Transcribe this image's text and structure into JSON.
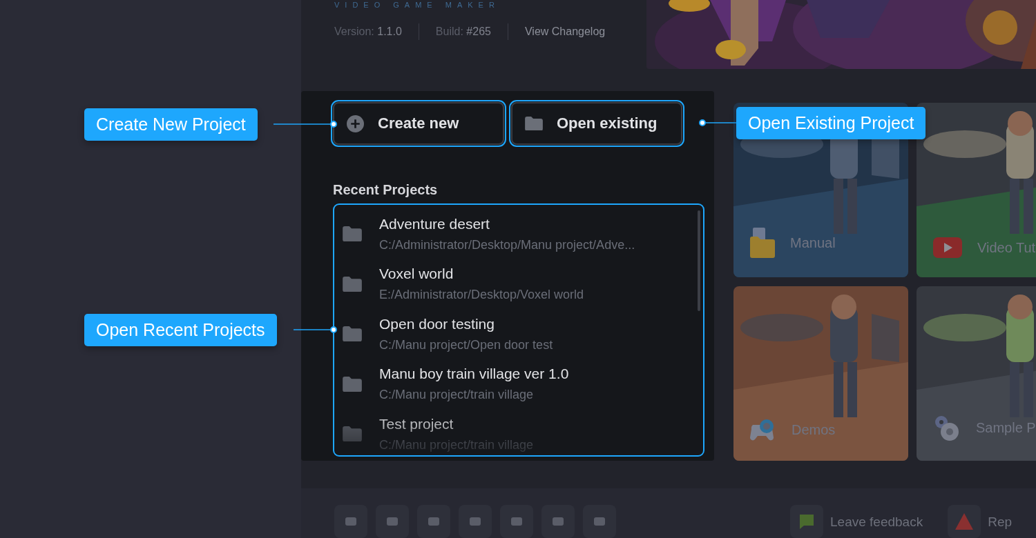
{
  "header": {
    "tagline": "VIDEO GAME MAKER",
    "version_label": "Version:",
    "version": "1.1.0",
    "build_label": "Build:",
    "build": "#265",
    "changelog": "View Changelog"
  },
  "actions": [
    {
      "kind": "create",
      "label": "Create new"
    },
    {
      "kind": "open",
      "label": "Open existing"
    }
  ],
  "recent": {
    "title": "Recent Projects",
    "items": [
      {
        "name": "Adventure desert",
        "path": "C:/Administrator/Desktop/Manu project/Adve..."
      },
      {
        "name": "Voxel world",
        "path": "E:/Administrator/Desktop/Voxel world"
      },
      {
        "name": "Open door testing",
        "path": "C:/Manu project/Open door test"
      },
      {
        "name": "Manu boy train village ver 1.0",
        "path": "C:/Manu project/train village"
      },
      {
        "name": "Test project",
        "path": "C:/Manu project/train village"
      }
    ]
  },
  "cards": [
    {
      "kind": "manual",
      "label": "Manual"
    },
    {
      "kind": "video",
      "label": "Video Tut"
    },
    {
      "kind": "demos",
      "label": "Demos"
    },
    {
      "kind": "samples",
      "label": "Sample P"
    }
  ],
  "footer": {
    "links": [
      {
        "kind": "feedback",
        "label": "Leave feedback"
      },
      {
        "kind": "report",
        "label": "Rep"
      }
    ]
  },
  "callouts": [
    {
      "label": "Create New Project"
    },
    {
      "label": "Open Existing Project"
    },
    {
      "label": "Open Recent Projects"
    }
  ]
}
